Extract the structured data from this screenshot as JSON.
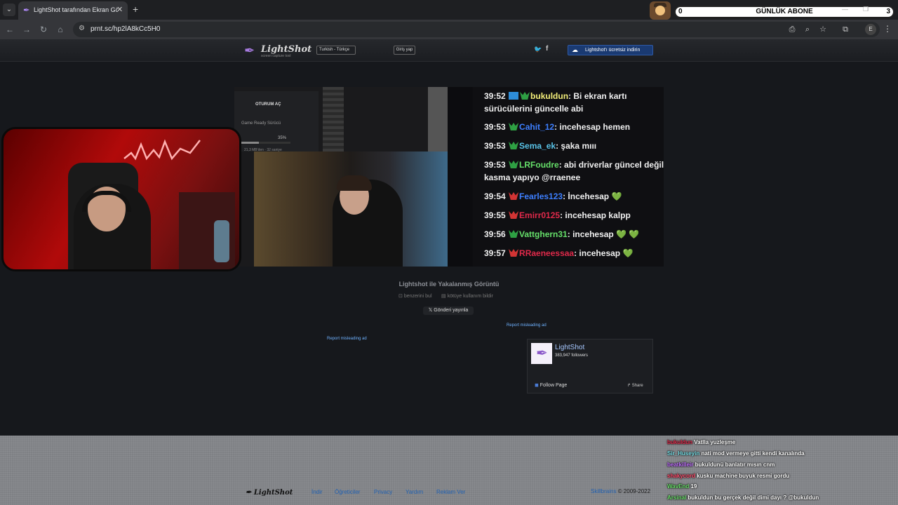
{
  "browser": {
    "tab_title": "LightShot tarafından Ekran Görüntüsü",
    "url": "prnt.sc/hp2lA8kCc5H0",
    "profile_initial": "E"
  },
  "overlay": {
    "sub_left_count": "0",
    "sub_title": "GÜNLÜK ABONE",
    "sub_right_count": "3"
  },
  "header": {
    "logo": "LightShot",
    "logo_sub": "screen capture tool",
    "language": "Turkish - Türkçe",
    "login": "Giriş yap",
    "download": "Lightshot'ı ücretsiz indirin"
  },
  "screenshot": {
    "panel_login": "OTURUM AÇ",
    "panel_driver": "Game Ready Sürücü",
    "panel_percent": "35%",
    "panel_progress": 0.35,
    "panel_size": "21,3 MB'den · 32 saniye",
    "chat": [
      {
        "time": "39:52",
        "user": "bukuldun",
        "user_color": "#f5f07a",
        "text": ": Bi ekran kartı",
        "badges": [
          "blue",
          "green"
        ]
      },
      {
        "time": "",
        "user": "",
        "user_color": "#ffffff",
        "text": "sürücülerini güncelle abi",
        "badges": []
      },
      {
        "time": "39:53",
        "user": "Cahit_12",
        "user_color": "#3d7fff",
        "text": ": incehesap hemen",
        "badges": [
          "green"
        ]
      },
      {
        "time": "39:53",
        "user": "Sema_ek",
        "user_color": "#59c3e8",
        "text": ": şaka mııı",
        "badges": [
          "green"
        ]
      },
      {
        "time": "39:53",
        "user": "LRFoudre",
        "user_color": "#66e06a",
        "text": ": abi driverlar güncel değilse",
        "badges": [
          "green"
        ]
      },
      {
        "time": "",
        "user": "",
        "user_color": "#ffffff",
        "text": "kasma yapıyo @rraenee",
        "badges": []
      },
      {
        "time": "39:54",
        "user": "Fearles123",
        "user_color": "#3d7fff",
        "text": ": İncehesap",
        "badges": [
          "red"
        ],
        "hearts": "💚"
      },
      {
        "time": "39:55",
        "user": "Emirr0125",
        "user_color": "#e0294a",
        "text": ": incehesap kalpp",
        "badges": [
          "red"
        ]
      },
      {
        "time": "39:56",
        "user": "Vattghern31",
        "user_color": "#66e06a",
        "text": ": incehesap",
        "badges": [
          "green"
        ],
        "hearts": "💚 💚"
      },
      {
        "time": "39:57",
        "user": "RRaeneessaa",
        "user_color": "#e0294a",
        "text": ": incehesap",
        "badges": [
          "red"
        ],
        "hearts": "💚"
      }
    ]
  },
  "page": {
    "captured_title": "Lightshot ile Yakalanmış Görüntü",
    "find_similar": "benzerini bul",
    "report_abuse": "kötüye kullanım bildir",
    "tweet": "Gönderi yayınla",
    "report_ad": "Report misleading ad"
  },
  "facebook": {
    "name": "LightShot",
    "followers": "383,947 followers",
    "follow": "Follow Page",
    "share": "Share"
  },
  "footer": {
    "logo": "LightShot",
    "links": [
      "İndir",
      "Öğreticiler",
      "Privacy",
      "Yardım",
      "Reklam Ver"
    ],
    "copy_link": "Skillbrains",
    "copy_text": " © 2009-2022"
  },
  "live_chat": [
    {
      "user": "bukuldun",
      "color": "#e0294a",
      "text": "Vatlla yuzleşme"
    },
    {
      "user": "Sir_Huseyin",
      "color": "#7be0e8",
      "text": "nati mod vermeye gitti kendi kanalında"
    },
    {
      "user": "beatkilleir",
      "color": "#c070ff",
      "text": "bukuldunü banlatır mısın cnm"
    },
    {
      "user": "shakycord",
      "color": "#ff4d6b",
      "text": "kusku machine buyuk resmi gordu"
    },
    {
      "user": "WavEnd",
      "color": "#6ce06c",
      "text": "19"
    },
    {
      "user": "Arsinal",
      "color": "#6ce06c",
      "text": "bukuldun bu gerçek değil dimi dayı ? @bukuldun"
    }
  ]
}
